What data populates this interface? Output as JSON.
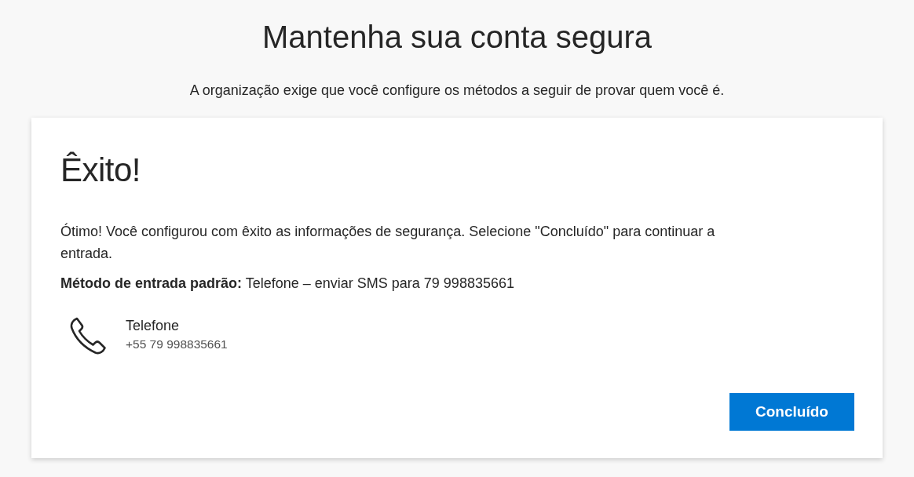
{
  "page": {
    "title": "Mantenha sua conta segura",
    "subtitle": "A organização exige que você configure os métodos a seguir de provar quem você é."
  },
  "card": {
    "heading": "Êxito!",
    "message": "Ótimo! Você configurou com êxito as informações de segurança. Selecione \"Concluído\" para continuar a entrada.",
    "default_method": "**Método de entrada padrão:** Telefone – enviar SMS para 79 998835661",
    "methods": [
      {
        "kind": "phone",
        "name": "Telefone",
        "detail": "+55 79 998835661"
      }
    ],
    "button": "Concluído"
  }
}
